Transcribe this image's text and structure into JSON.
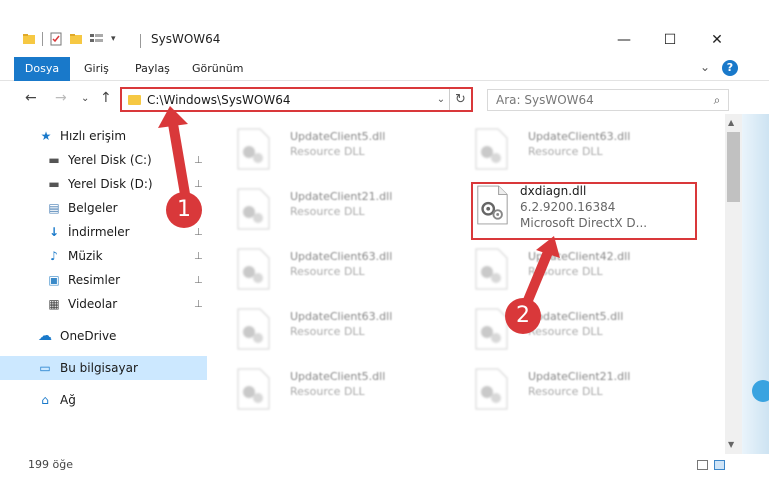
{
  "window": {
    "title": "SysWOW64",
    "minimize": "—",
    "maximize": "☐",
    "close": "✕"
  },
  "ribbon": {
    "tabs": [
      "Dosya",
      "Giriş",
      "Paylaş",
      "Görünüm"
    ],
    "expand_glyph": "⌄",
    "help_glyph": "?"
  },
  "nav": {
    "back": "←",
    "forward": "→",
    "recent": "⌄",
    "up": "↑",
    "address": "C:\\Windows\\SysWOW64",
    "address_dropdown": "⌄",
    "refresh": "↻",
    "search_placeholder": "Ara: SysWOW64",
    "search_icon": "⌕"
  },
  "sidebar": {
    "items": [
      {
        "label": "Hızlı erişim",
        "icon": "star-icon",
        "glyph": "★",
        "pinned": false
      },
      {
        "label": "Yerel Disk (C:)",
        "icon": "drive-icon",
        "glyph": "▬",
        "pinned": true
      },
      {
        "label": "Yerel Disk (D:)",
        "icon": "drive-icon",
        "glyph": "▬",
        "pinned": true
      },
      {
        "label": "Belgeler",
        "icon": "documents-icon",
        "glyph": "▤",
        "pinned": true
      },
      {
        "label": "İndirmeler",
        "icon": "download-icon",
        "glyph": "↓",
        "pinned": true
      },
      {
        "label": "Müzik",
        "icon": "music-icon",
        "glyph": "♪",
        "pinned": true
      },
      {
        "label": "Resimler",
        "icon": "pictures-icon",
        "glyph": "▣",
        "pinned": true
      },
      {
        "label": "Videolar",
        "icon": "videos-icon",
        "glyph": "▦",
        "pinned": true
      },
      {
        "label": "OneDrive",
        "icon": "cloud-icon",
        "glyph": "☁",
        "pinned": false
      },
      {
        "label": "Bu bilgisayar",
        "icon": "computer-icon",
        "glyph": "▭",
        "pinned": false
      },
      {
        "label": "Ağ",
        "icon": "network-icon",
        "glyph": "⌂",
        "pinned": false
      }
    ],
    "pin_glyph": "📌"
  },
  "files": {
    "left": [
      {
        "name": "UpdateClient5.dll",
        "type": "Resource DLL"
      },
      {
        "name": "UpdateClient21.dll",
        "type": "Resource DLL"
      },
      {
        "name": "UpdateClient63.dll",
        "type": "Resource DLL"
      },
      {
        "name": "UpdateClient63.dll",
        "type": "Resource DLL"
      },
      {
        "name": "UpdateClient5.dll",
        "type": "Resource DLL"
      }
    ],
    "right": [
      {
        "name": "UpdateClient63.dll",
        "type": "Resource DLL"
      },
      {
        "name": "dxdiagn.dll",
        "type": "6.2.9200.16384",
        "desc": "Microsoft DirectX D..."
      },
      {
        "name": "UpdateClient42.dll",
        "type": "Resource DLL"
      },
      {
        "name": "UpdateClient5.dll",
        "type": "Resource DLL"
      },
      {
        "name": "UpdateClient21.dll",
        "type": "Resource DLL"
      }
    ]
  },
  "status": {
    "count": "199 öğe"
  },
  "callouts": [
    "1",
    "2"
  ],
  "colors": {
    "accent": "#1979ca",
    "highlight": "#d9383a",
    "selected": "#cce8ff"
  }
}
